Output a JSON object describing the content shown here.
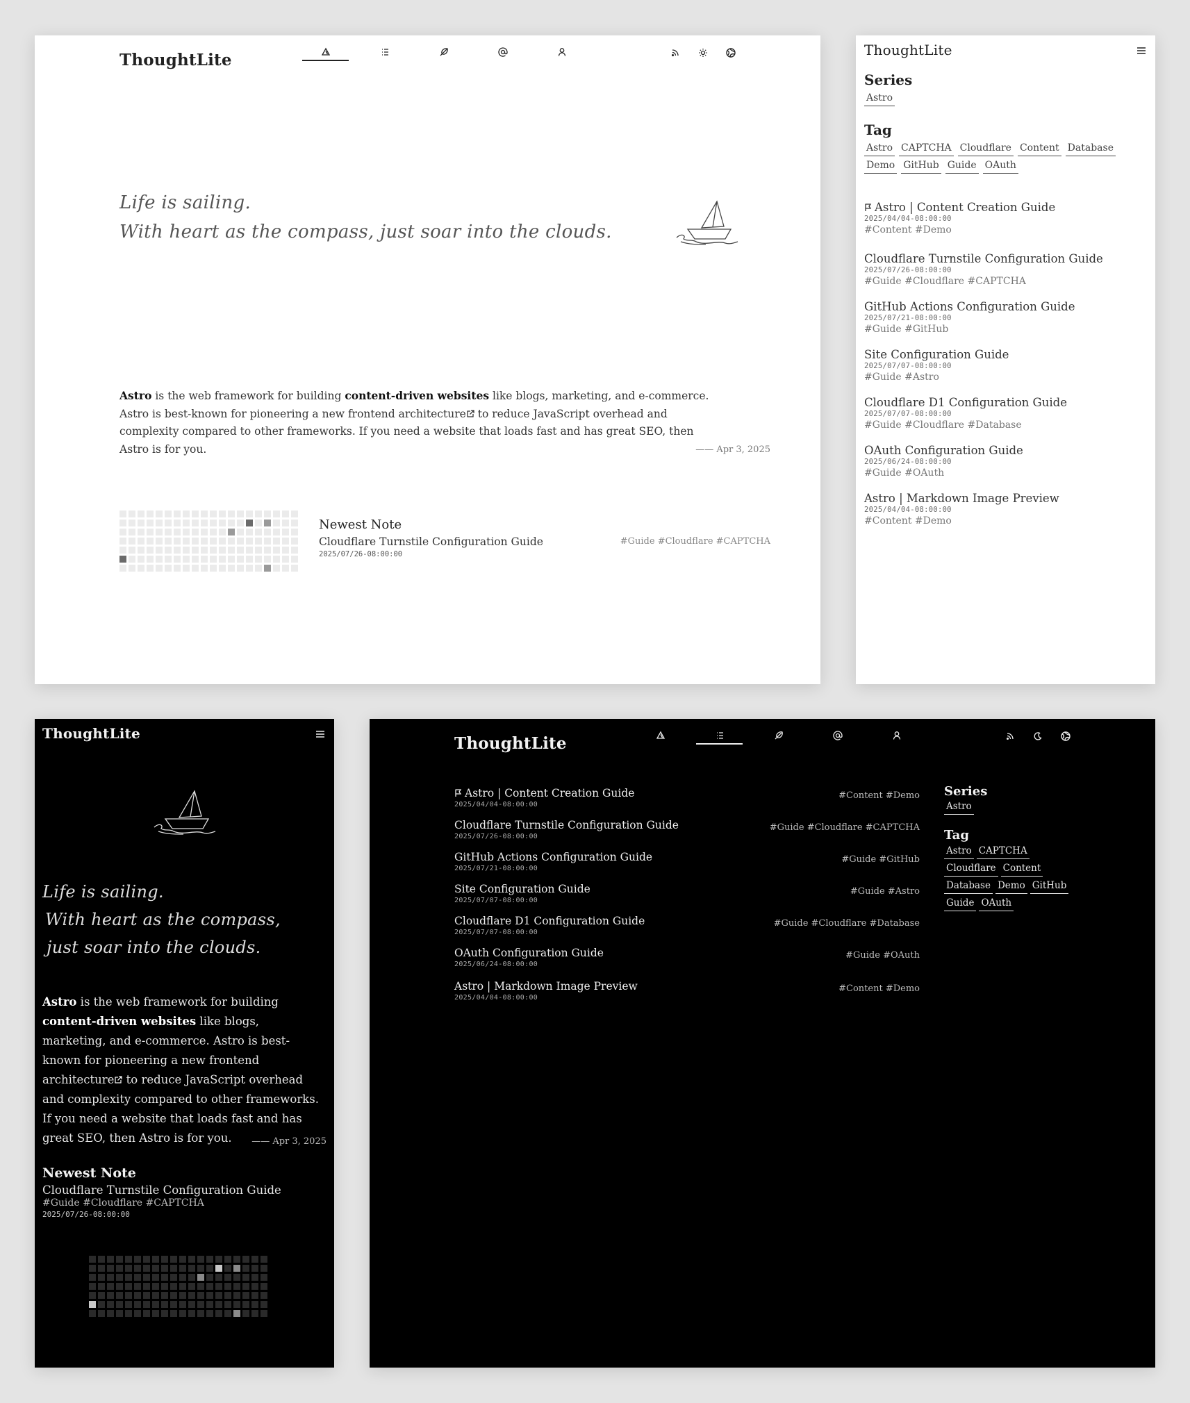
{
  "brand": "ThoughtLite",
  "quote": {
    "line1": "Life is sailing.",
    "line2": "With heart as the compass, just soar into the clouds.",
    "m_line1": "Life is sailing.",
    "m_line2": "With heart as the compass,",
    "m_line3": "just soar into the clouds."
  },
  "intro": {
    "astro": "Astro",
    "p1": " is the web framework for building ",
    "strong": "content-driven websites",
    "p2": " like blogs, marketing, and e-commerce. Astro is best-known for pioneering a new frontend architecture",
    "p3": " to reduce JavaScript overhead and complexity compared to other frameworks. If you need a website that loads fast and has great SEO, then Astro is for you.",
    "date": "—— Apr 3, 2025"
  },
  "newest": {
    "heading": "Newest Note",
    "title": "Cloudflare Turnstile Configuration Guide",
    "date": "2025/07/26-08:00:00",
    "tags": "#Guide #Cloudflare #CAPTCHA"
  },
  "heatmap_active": [
    {
      "row": 1,
      "col": 14,
      "level": 3
    },
    {
      "row": 1,
      "col": 16,
      "level": 2
    },
    {
      "row": 2,
      "col": 12,
      "level": 2
    },
    {
      "row": 5,
      "col": 0,
      "level": 3
    },
    {
      "row": 6,
      "col": 16,
      "level": 2
    }
  ],
  "sidebar": {
    "series_title": "Series",
    "series": [
      "Astro"
    ],
    "tag_title": "Tag",
    "tags": [
      "Astro",
      "CAPTCHA",
      "Cloudflare",
      "Content",
      "Database",
      "Demo",
      "GitHub",
      "Guide",
      "OAuth"
    ]
  },
  "posts": [
    {
      "title": "Astro | Content Creation Guide",
      "date": "2025/04/04-08:00:00",
      "tags": "#Content #Demo",
      "pinned": true
    },
    {
      "title": "Cloudflare Turnstile Configuration Guide",
      "date": "2025/07/26-08:00:00",
      "tags": "#Guide #Cloudflare #CAPTCHA",
      "pinned": false
    },
    {
      "title": "GitHub Actions Configuration Guide",
      "date": "2025/07/21-08:00:00",
      "tags": "#Guide #GitHub",
      "pinned": false
    },
    {
      "title": "Site Configuration Guide",
      "date": "2025/07/07-08:00:00",
      "tags": "#Guide #Astro",
      "pinned": false
    },
    {
      "title": "Cloudflare D1 Configuration Guide",
      "date": "2025/07/07-08:00:00",
      "tags": "#Guide #Cloudflare #Database",
      "pinned": false
    },
    {
      "title": "OAuth Configuration Guide",
      "date": "2025/06/24-08:00:00",
      "tags": "#Guide #OAuth",
      "pinned": false
    },
    {
      "title": "Astro | Markdown Image Preview",
      "date": "2025/04/04-08:00:00",
      "tags": "#Content #Demo",
      "pinned": false
    }
  ],
  "nav_icons": [
    "home-icon",
    "list-icon",
    "feather-icon",
    "at-icon",
    "user-icon"
  ],
  "util_icons": [
    "rss-icon",
    "sun-icon",
    "moon-icon",
    "language-icon",
    "menu-icon"
  ],
  "colors": {
    "light_bg": "#ffffff",
    "dark_bg": "#000000",
    "page_bg": "#e4e4e4"
  }
}
